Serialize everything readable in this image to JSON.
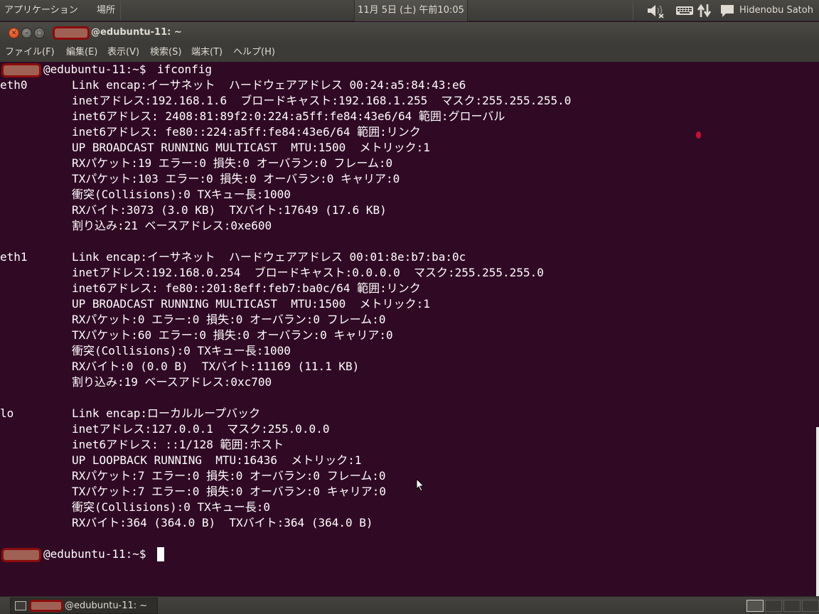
{
  "top_panel": {
    "applications_menu": "アプリケーション",
    "places_menu": "場所",
    "clock": "11月 5日 (土) 午前10:05",
    "user_name": "Hidenobu Satoh",
    "icons": [
      "volume-muted-icon",
      "keyboard-icon",
      "network-icon",
      "chat-icon"
    ]
  },
  "window": {
    "title": "@edubuntu-11: ~",
    "buttons": [
      "close",
      "minimize",
      "maximize"
    ]
  },
  "menu_bar": {
    "file": "ファイル(F)",
    "edit": "編集(E)",
    "view": "表示(V)",
    "search": "検索(S)",
    "terminal": "端末(T)",
    "help": "ヘルプ(H)"
  },
  "terminal": {
    "prompt": "@edubuntu-11:~$",
    "command": "ifconfig",
    "eth0": {
      "name": "eth0",
      "lines": [
        "Link encap:イーサネット  ハードウェアアドレス 00:24:a5:84:43:e6",
        "inetアドレス:192.168.1.6  ブロードキャスト:192.168.1.255  マスク:255.255.255.0",
        "inet6アドレス: 2408:81:89f2:0:224:a5ff:fe84:43e6/64 範囲:グローバル",
        "inet6アドレス: fe80::224:a5ff:fe84:43e6/64 範囲:リンク",
        "UP BROADCAST RUNNING MULTICAST  MTU:1500  メトリック:1",
        "RXパケット:19 エラー:0 損失:0 オーバラン:0 フレーム:0",
        "TXパケット:103 エラー:0 損失:0 オーバラン:0 キャリア:0",
        "衝突(Collisions):0 TXキュー長:1000",
        "RXバイト:3073 (3.0 KB)  TXバイト:17649 (17.6 KB)",
        "割り込み:21 ベースアドレス:0xe600"
      ]
    },
    "eth1": {
      "name": "eth1",
      "lines": [
        "Link encap:イーサネット  ハードウェアアドレス 00:01:8e:b7:ba:0c",
        "inetアドレス:192.168.0.254  ブロードキャスト:0.0.0.0  マスク:255.255.255.0",
        "inet6アドレス: fe80::201:8eff:feb7:ba0c/64 範囲:リンク",
        "UP BROADCAST RUNNING MULTICAST  MTU:1500  メトリック:1",
        "RXパケット:0 エラー:0 損失:0 オーバラン:0 フレーム:0",
        "TXパケット:60 エラー:0 損失:0 オーバラン:0 キャリア:0",
        "衝突(Collisions):0 TXキュー長:1000",
        "RXバイト:0 (0.0 B)  TXバイト:11169 (11.1 KB)",
        "割り込み:19 ベースアドレス:0xc700"
      ]
    },
    "lo": {
      "name": "lo",
      "lines": [
        "Link encap:ローカルループバック",
        "inetアドレス:127.0.0.1  マスク:255.0.0.0",
        "inet6アドレス: ::1/128 範囲:ホスト",
        "UP LOOPBACK RUNNING  MTU:16436  メトリック:1",
        "RXパケット:7 エラー:0 損失:0 オーバラン:0 フレーム:0",
        "TXパケット:7 エラー:0 損失:0 オーバラン:0 キャリア:0",
        "衝突(Collisions):0 TXキュー長:0",
        "RXバイト:364 (364.0 B)  TXバイト:364 (364.0 B)"
      ]
    }
  },
  "bottom_panel": {
    "taskbar_label": "@edubuntu-11: ~"
  },
  "colors": {
    "terminal_background": "#300a24",
    "terminal_text": "#ffffff",
    "panel_background": "#3c3b37",
    "close_button": "#e4541c"
  }
}
